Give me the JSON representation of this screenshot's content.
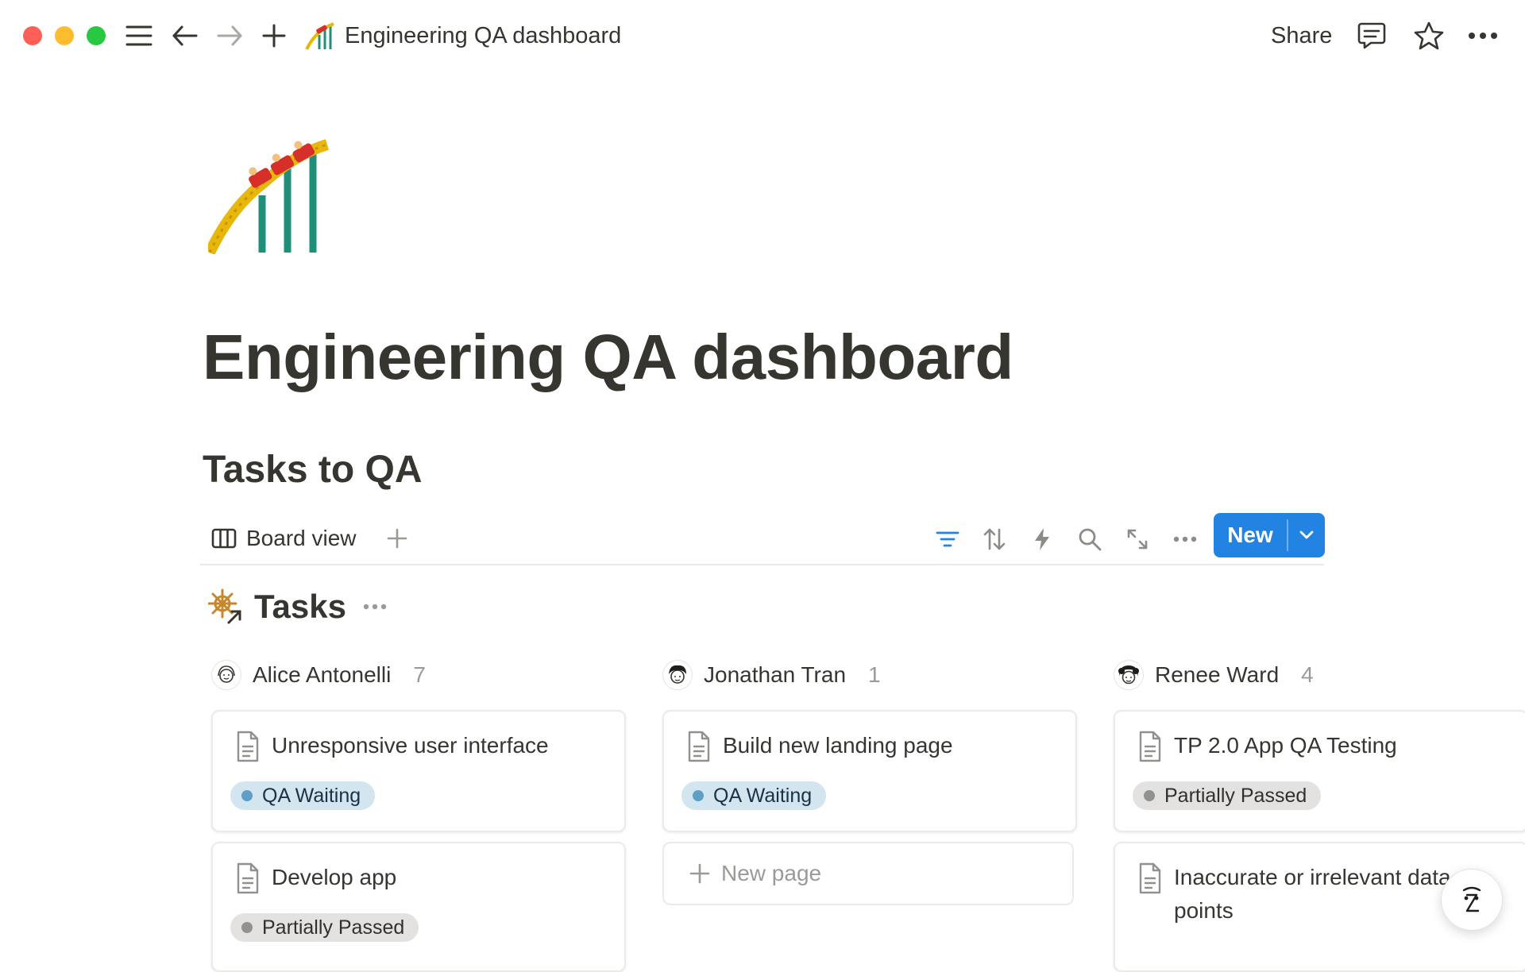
{
  "window": {
    "title": "Engineering QA dashboard",
    "share_label": "Share"
  },
  "page": {
    "title": "Engineering QA dashboard",
    "section_title": "Tasks to QA"
  },
  "view": {
    "tab_label": "Board view",
    "new_label": "New"
  },
  "database": {
    "title": "Tasks"
  },
  "colors": {
    "accent": "#2383e2",
    "qa_waiting_dot": "#5e9fc8",
    "partial_dot": "#91918e"
  },
  "columns": [
    {
      "name": "Alice Antonelli",
      "count": "7",
      "cards": [
        {
          "title": "Unresponsive user interface",
          "status": "QA Waiting"
        },
        {
          "title": "Develop app",
          "status": "Partially Passed"
        }
      ]
    },
    {
      "name": "Jonathan Tran",
      "count": "1",
      "cards": [
        {
          "title": "Build new landing page",
          "status": "QA Waiting"
        }
      ],
      "new_page_label": "New page"
    },
    {
      "name": "Renee Ward",
      "count": "4",
      "cards": [
        {
          "title": "TP 2.0 App QA Testing",
          "status": "Partially Passed"
        },
        {
          "title": "Inaccurate or irrelevant data points",
          "status": ""
        }
      ]
    }
  ]
}
